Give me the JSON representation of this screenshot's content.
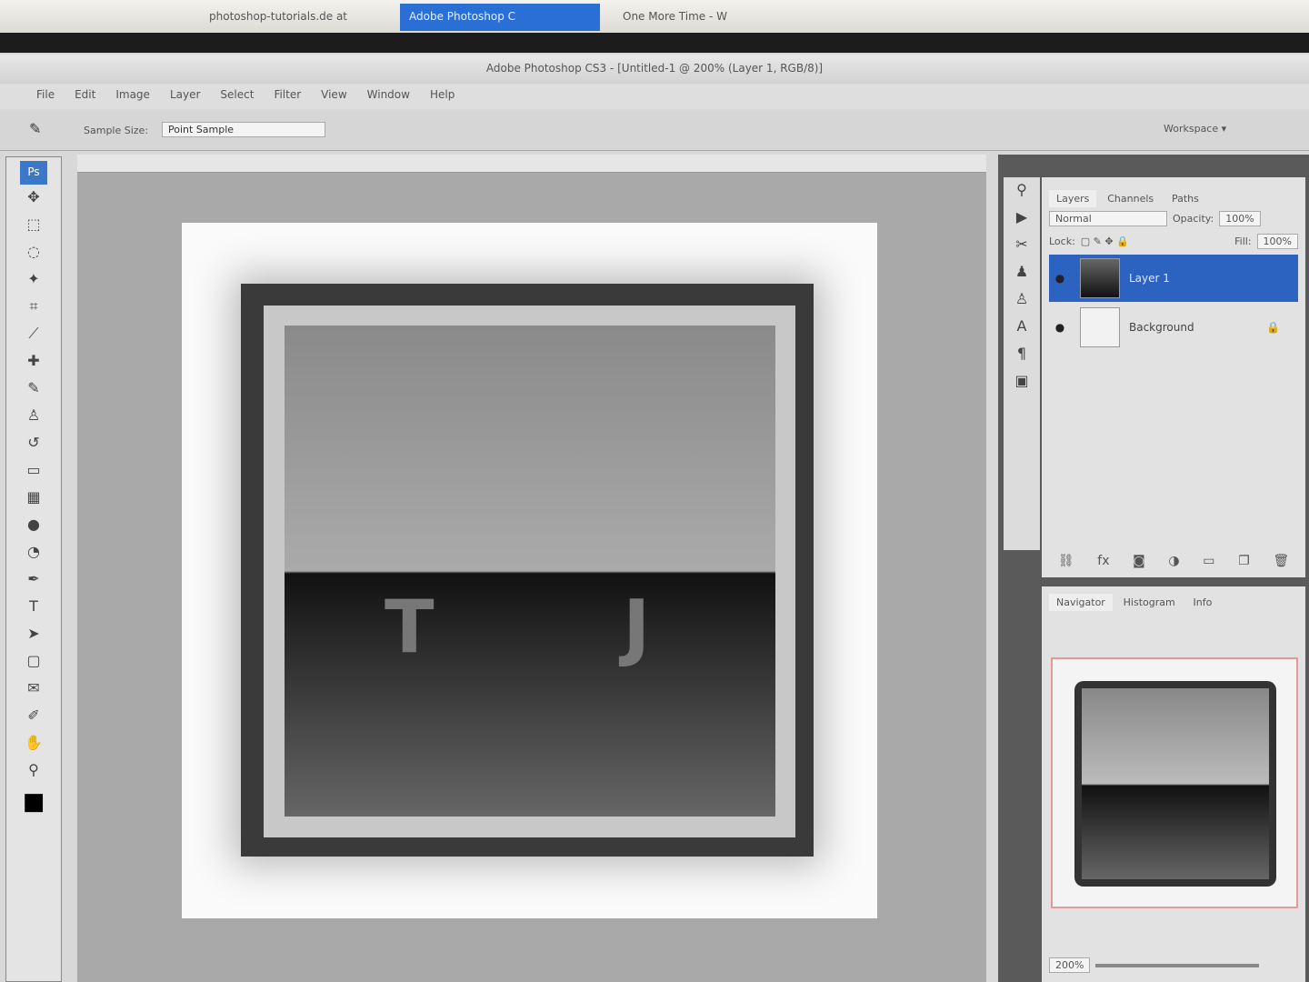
{
  "browser": {
    "tabs": [
      {
        "label": "photoshop-tutorials.de at"
      },
      {
        "label": "Adobe Photoshop C"
      },
      {
        "label": "One More Time - W"
      }
    ]
  },
  "window": {
    "title": "Adobe Photoshop CS3 - [Untitled-1 @ 200% (Layer 1, RGB/8)]"
  },
  "menu": [
    "File",
    "Edit",
    "Image",
    "Layer",
    "Select",
    "Filter",
    "View",
    "Window",
    "Help"
  ],
  "options": {
    "sample_size_label": "Sample Size:",
    "sample_size_value": "Point Sample",
    "workspace": "Workspace ▾"
  },
  "canvas": {
    "text": "T J"
  },
  "layers_panel": {
    "tabs": [
      "Layers",
      "Channels",
      "Paths"
    ],
    "blend_mode": "Normal",
    "opacity_label": "Opacity:",
    "opacity": "100%",
    "lock_label": "Lock:",
    "fill_label": "Fill:",
    "fill": "100%",
    "layers": [
      {
        "name": "Layer 1",
        "selected": true
      },
      {
        "name": "Background",
        "locked": true
      }
    ]
  },
  "navigator_panel": {
    "tabs": [
      "Navigator",
      "Histogram",
      "Info"
    ],
    "zoom": "200%"
  }
}
